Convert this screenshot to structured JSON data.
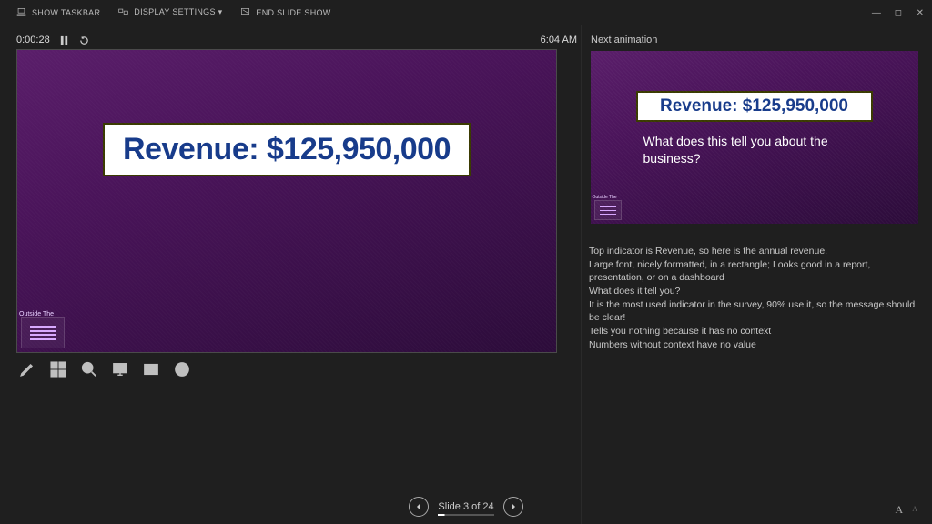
{
  "topbar": {
    "show_taskbar": "SHOW TASKBAR",
    "display_settings": "DISPLAY SETTINGS ▾",
    "end_slide_show": "END SLIDE SHOW"
  },
  "timer": {
    "elapsed": "0:00:28",
    "clock": "6:04 AM"
  },
  "current_slide": {
    "revenue_text": "Revenue: $125,950,000",
    "logo_text": "Outside The"
  },
  "next": {
    "label": "Next animation",
    "revenue_text": "Revenue: $125,950,000",
    "question": "What does this tell you about the business?",
    "logo_text": "Outside The"
  },
  "notes": {
    "lines": [
      "Top indicator is Revenue, so here is the annual revenue.",
      "Large font, nicely formatted, in a rectangle; Looks good in a report, presentation, or on a dashboard",
      "What does it tell you?",
      "It is the most used indicator in the survey, 90% use it, so the message should be clear!",
      "Tells you nothing because it has no context",
      "Numbers without context have no value"
    ]
  },
  "nav": {
    "slide_of": "Slide 3 of 24"
  },
  "font_ctl": {
    "big": "A",
    "small": "A"
  }
}
